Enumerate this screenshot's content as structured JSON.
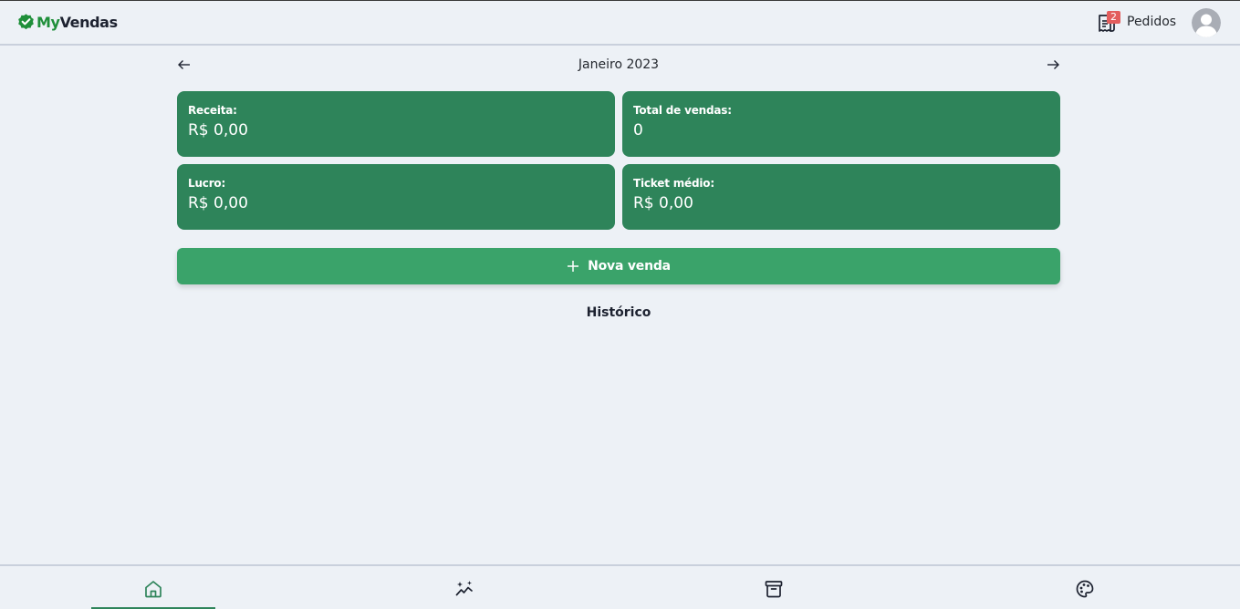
{
  "header": {
    "brand_my": "My",
    "brand_vendas": "Vendas",
    "orders_badge": "2",
    "orders_label": "Pedidos",
    "brand_color": "#1f8f3a"
  },
  "month_nav": {
    "label": "Janeiro 2023",
    "prev_icon": "arrow-left-icon",
    "next_icon": "arrow-right-icon"
  },
  "stats": [
    {
      "label": "Receita:",
      "value": "R$ 0,00"
    },
    {
      "label": "Total de vendas:",
      "value": "0"
    },
    {
      "label": "Lucro:",
      "value": "R$ 0,00"
    },
    {
      "label": "Ticket médio:",
      "value": "R$ 0,00"
    }
  ],
  "card_color": "#2e845a",
  "new_sale": {
    "label": "Nova venda",
    "icon": "plus-icon",
    "color": "#3aa36a"
  },
  "history": {
    "title": "Histórico"
  },
  "bottom_nav": {
    "items": [
      {
        "icon": "home-icon",
        "active": true
      },
      {
        "icon": "sparkle-chart-icon",
        "active": false
      },
      {
        "icon": "archive-box-icon",
        "active": false
      },
      {
        "icon": "palette-icon",
        "active": false
      }
    ]
  }
}
